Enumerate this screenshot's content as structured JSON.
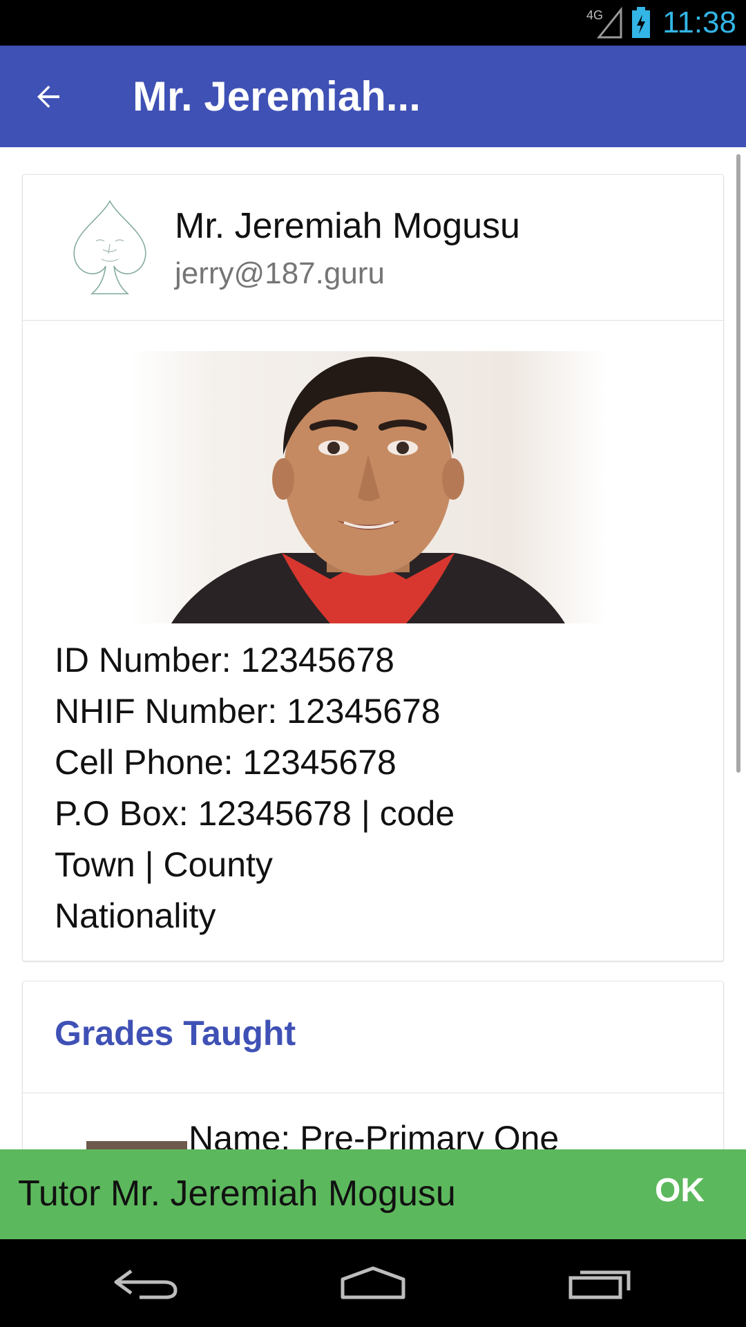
{
  "status_bar": {
    "network": "4G",
    "time": "11:38",
    "time_color": "#33b5e5"
  },
  "app_bar": {
    "title": "Mr. Jeremiah...",
    "color": "#3f51b5"
  },
  "profile": {
    "name": "Mr. Jeremiah Mogusu",
    "email": "jerry@187.guru",
    "avatar_icon": "spade-face-icon",
    "info_lines": [
      "ID Number: 12345678",
      "NHIF Number: 12345678",
      "Cell Phone: 12345678",
      "P.O Box: 12345678 | code",
      "Town | County",
      "Nationality"
    ]
  },
  "grades": {
    "title": "Grades Taught",
    "title_color": "#3f51b5",
    "items": [
      {
        "name": "Name: Pre-Primary One"
      }
    ]
  },
  "snackbar": {
    "text": "Tutor Mr. Jeremiah Mogusu",
    "action": "OK",
    "color": "#5cb85c"
  },
  "nav_bar": {
    "buttons": [
      "back-icon",
      "home-icon",
      "recents-icon"
    ]
  }
}
